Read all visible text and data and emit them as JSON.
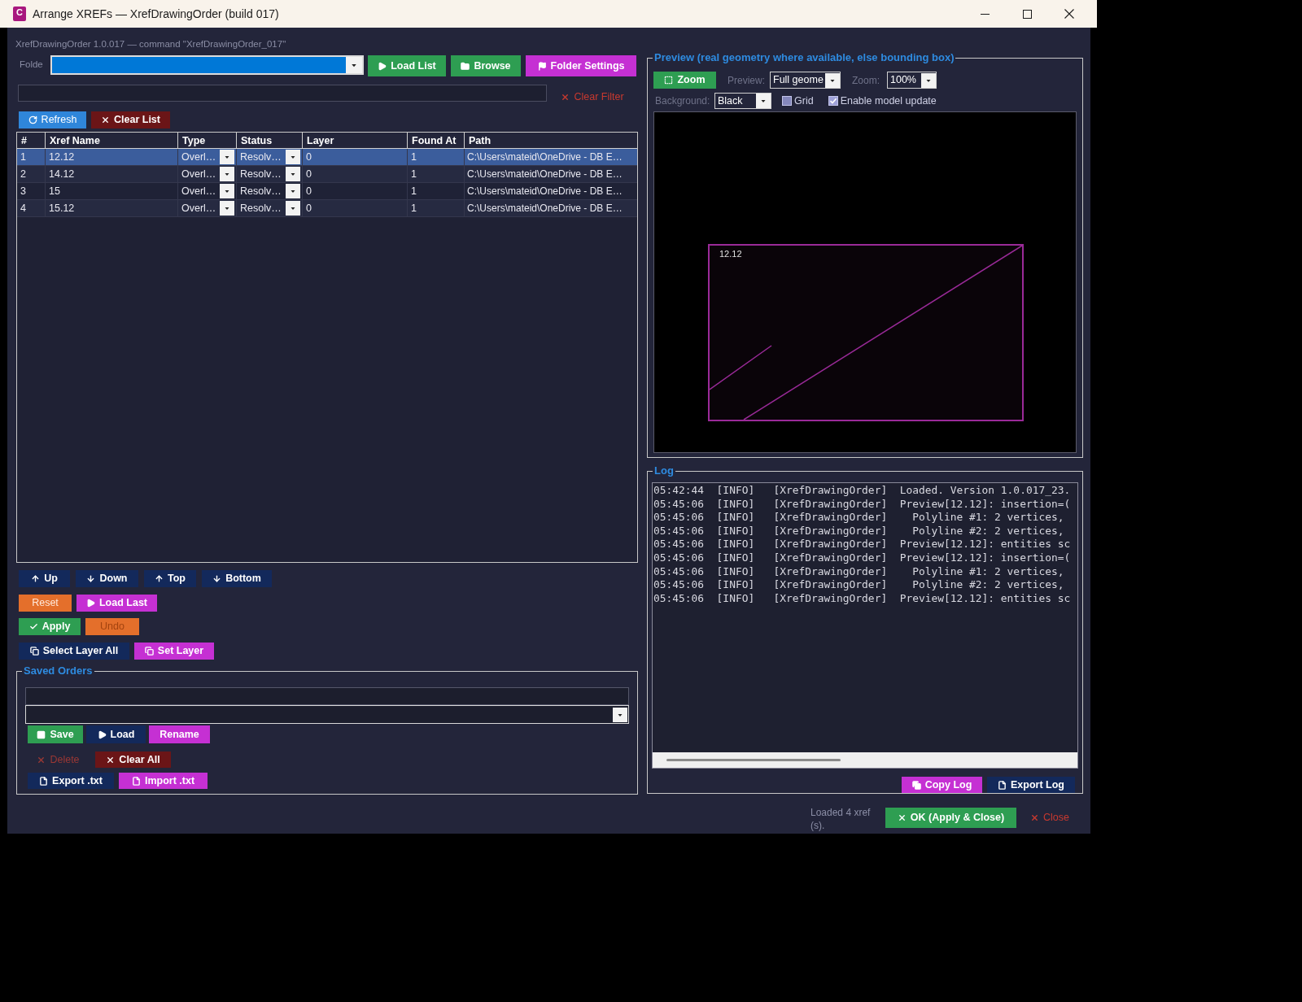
{
  "window": {
    "icon_text": "C",
    "title": "Arrange XREFs — XrefDrawingOrder (build 017)"
  },
  "subtitle": "XrefDrawingOrder 1.0.017 — command \"XrefDrawingOrder_017\"",
  "folder": {
    "label": "Folde",
    "buttons": [
      {
        "label": "Load List",
        "kind": "success"
      },
      {
        "label": "Browse",
        "kind": "success"
      },
      {
        "label": "Folder Settings",
        "kind": "accent"
      }
    ]
  },
  "filter": {
    "clear_button": {
      "label": "Clear Filter",
      "kind": "link"
    }
  },
  "list_buttons": [
    {
      "label": "Refresh",
      "kind": "info"
    },
    {
      "label": "Clear List",
      "kind": "danger"
    }
  ],
  "table": {
    "columns": [
      "#",
      "Xref Name",
      "Type",
      "Status",
      "Layer",
      "Found At",
      "Path"
    ],
    "rows": [
      {
        "index": "1",
        "name": "12.12",
        "type": "Overl…",
        "status": "Resolv…",
        "layer": "0",
        "found_at": "1",
        "path": "C:\\Users\\mateid\\OneDrive - DB E…",
        "selected": true
      },
      {
        "index": "2",
        "name": "14.12",
        "type": "Overl…",
        "status": "Resolv…",
        "layer": "0",
        "found_at": "1",
        "path": "C:\\Users\\mateid\\OneDrive - DB E…",
        "selected": false
      },
      {
        "index": "3",
        "name": "15",
        "type": "Overl…",
        "status": "Resolv…",
        "layer": "0",
        "found_at": "1",
        "path": "C:\\Users\\mateid\\OneDrive - DB E…",
        "selected": false
      },
      {
        "index": "4",
        "name": "15.12",
        "type": "Overl…",
        "status": "Resolv…",
        "layer": "0",
        "found_at": "1",
        "path": "C:\\Users\\mateid\\OneDrive - DB E…",
        "selected": false
      }
    ]
  },
  "move_buttons": [
    {
      "label": "Up",
      "kind": "navy"
    },
    {
      "label": "Down",
      "kind": "navy"
    },
    {
      "label": "Top",
      "kind": "navy"
    },
    {
      "label": "Bottom",
      "kind": "navy"
    }
  ],
  "action_rows": [
    [
      {
        "label": "Reset",
        "kind": "warning",
        "disabled": false
      },
      {
        "label": "Load Last",
        "kind": "accent",
        "disabled": false
      }
    ],
    [
      {
        "label": "Apply",
        "kind": "success",
        "disabled": false
      },
      {
        "label": "Undo",
        "kind": "warning",
        "disabled": true
      }
    ],
    [
      {
        "label": "Select Layer All",
        "kind": "navy",
        "disabled": false
      },
      {
        "label": "Set Layer",
        "kind": "accent",
        "disabled": false
      }
    ]
  ],
  "saved_orders": {
    "title": "Saved Orders",
    "button_rows": [
      [
        {
          "label": "Save",
          "kind": "success",
          "disabled": false
        },
        {
          "label": "Load",
          "kind": "navy",
          "disabled": false
        },
        {
          "label": "Rename",
          "kind": "accent",
          "disabled": false
        }
      ],
      [
        {
          "label": "Delete",
          "kind": "link",
          "disabled": true
        },
        {
          "label": "Clear All",
          "kind": "danger",
          "disabled": false
        }
      ],
      [
        {
          "label": "Export .txt",
          "kind": "navy",
          "disabled": false
        },
        {
          "label": "Import .txt",
          "kind": "accent",
          "disabled": false
        }
      ]
    ]
  },
  "preview": {
    "title": "Preview (real geometry where available, else bounding box)",
    "zoom_button": {
      "label": "Zoom",
      "kind": "success"
    },
    "mode_label": "Preview:",
    "mode_value": "Full geome",
    "zoom_label": "Zoom:",
    "zoom_value": "100%",
    "background_label": "Background:",
    "background_value": "Black",
    "grid": {
      "label": "Grid",
      "checked": false
    },
    "model_update": {
      "label": "Enable model update",
      "checked": true
    },
    "canvas": {
      "label": "12.12"
    }
  },
  "log": {
    "title": "Log",
    "lines": [
      "05:42:44  [INFO]   [XrefDrawingOrder]  Loaded. Version 1.0.017_23.",
      "05:45:06  [INFO]   [XrefDrawingOrder]  Preview[12.12]: insertion=(",
      "05:45:06  [INFO]   [XrefDrawingOrder]    Polyline #1: 2 vertices,",
      "05:45:06  [INFO]   [XrefDrawingOrder]    Polyline #2: 2 vertices,",
      "05:45:06  [INFO]   [XrefDrawingOrder]  Preview[12.12]: entities sc",
      "05:45:06  [INFO]   [XrefDrawingOrder]  Preview[12.12]: insertion=(",
      "05:45:06  [INFO]   [XrefDrawingOrder]    Polyline #1: 2 vertices,",
      "05:45:06  [INFO]   [XrefDrawingOrder]    Polyline #2: 2 vertices,",
      "05:45:06  [INFO]   [XrefDrawingOrder]  Preview[12.12]: entities sc"
    ],
    "buttons": [
      {
        "label": "Copy Log",
        "kind": "accent"
      },
      {
        "label": "Export Log",
        "kind": "navy"
      }
    ]
  },
  "footer": {
    "status": "Loaded 4 xref(s).",
    "buttons": [
      {
        "label": "OK (Apply & Close)",
        "kind": "success"
      },
      {
        "label": "Close",
        "kind": "link"
      }
    ]
  }
}
